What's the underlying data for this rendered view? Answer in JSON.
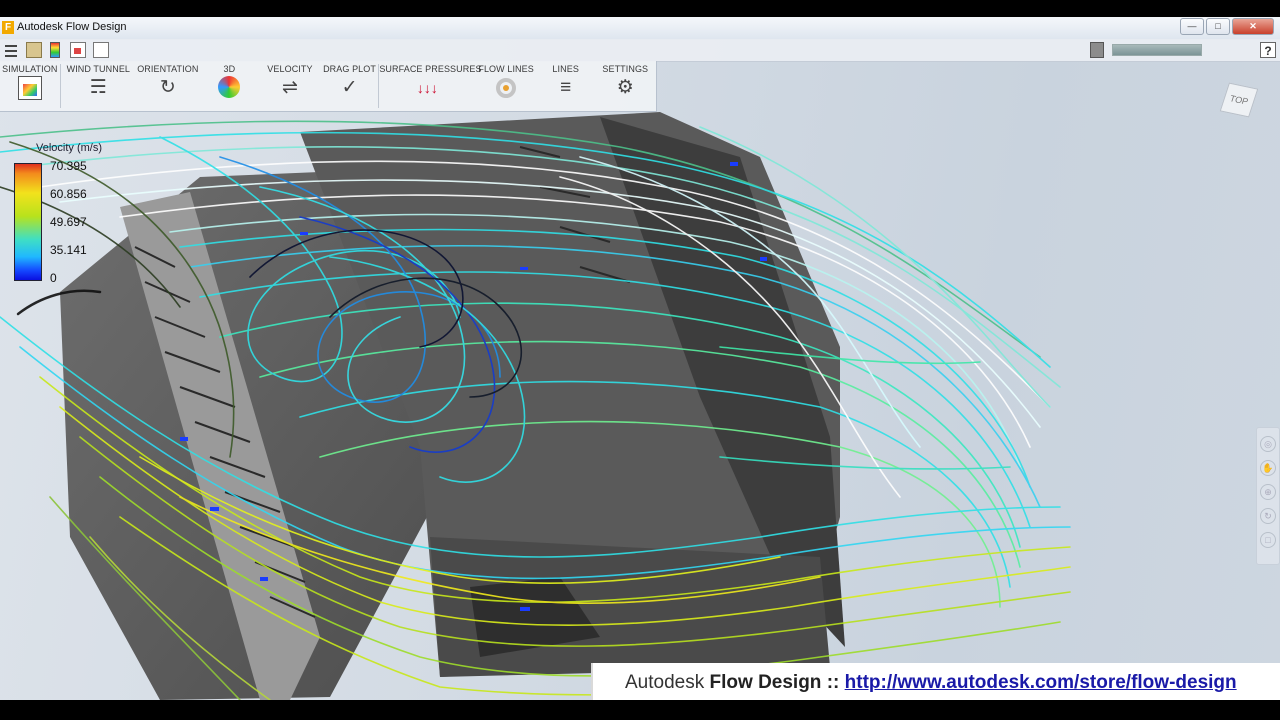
{
  "window": {
    "title": "Autodesk Flow Design"
  },
  "quickbar": {
    "progress_fraction": 1.0,
    "help_label": "?"
  },
  "toolbar": {
    "simulation": "SIMULATION",
    "wind_tunnel": "WIND TUNNEL",
    "orientation": "ORIENTATION",
    "three_d": "3D",
    "velocity": "VELOCITY",
    "drag_plot": "DRAG PLOT",
    "surface_pressures": "SURFACE PRESSURES",
    "flow_lines": "FLOW LINES",
    "lines": "LINES",
    "settings": "SETTINGS"
  },
  "legend": {
    "title": "Velocity (m/s)",
    "ticks": [
      "70.395",
      "60.856",
      "49.697",
      "35.141",
      "0"
    ]
  },
  "viewcube": {
    "face_label": "TOP"
  },
  "watermark": {
    "prefix": "Autodesk",
    "product": "Flow Design",
    "separator": "::",
    "url": "http://www.autodesk.com/store/flow-design"
  },
  "colors": {
    "accent": "#f2a900",
    "link": "#1a1aa8",
    "flow_cyan": "#2fe0e6",
    "flow_yellow": "#c8e81a"
  }
}
